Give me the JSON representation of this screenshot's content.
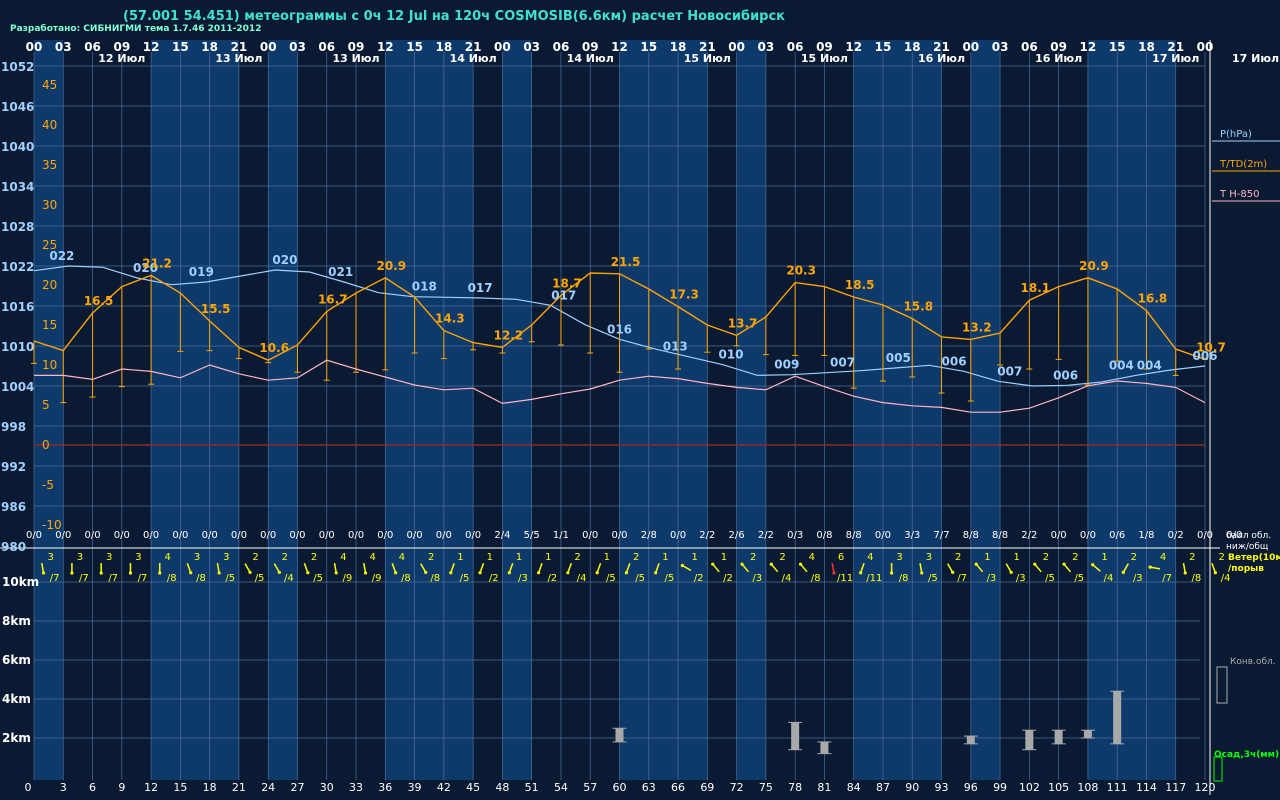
{
  "header": {
    "title": "(57.001 54.451) метеограммы с  0ч 12 Jul на 120ч COSMOSIB(6.6км) расчет Новосибирск",
    "credit": "Разработано: СИБНИГМИ тема 1.7.46 2011-2012"
  },
  "colors": {
    "background": "#0b1a33",
    "band_dark": "#0b1a33",
    "band_light": "#0e3a6b",
    "pressure": "#9fd0ff",
    "temperature": "#ffa500",
    "t850": "#ffb6c1",
    "wind": "#ffff00",
    "wind_gust_alert": "#ff3030",
    "cloud_bar": "#a9a9a9",
    "zero_line": "#8b2a2a",
    "grid": "#4b6e99"
  },
  "time_axis": {
    "top_hours": [
      "00",
      "03",
      "06",
      "09",
      "12",
      "15",
      "18",
      "21",
      "00",
      "03",
      "06",
      "09",
      "12",
      "15",
      "18",
      "21",
      "00",
      "03",
      "06",
      "09",
      "12",
      "15",
      "18",
      "21",
      "00",
      "03",
      "06",
      "09",
      "12",
      "15",
      "18",
      "21",
      "00",
      "03",
      "06",
      "09",
      "12",
      "15",
      "18",
      "21",
      "00"
    ],
    "day_labels": [
      "12 Июл",
      "13 Июл",
      "13 Июл",
      "14 Июл",
      "14 Июл",
      "15 Июл",
      "15 Июл",
      "16 Июл",
      "16 Июл",
      "17 Июл"
    ],
    "right_day_label": "17 Июл",
    "bottom_hours": [
      "0",
      "3",
      "6",
      "9",
      "12",
      "15",
      "18",
      "21",
      "24",
      "27",
      "30",
      "33",
      "36",
      "39",
      "42",
      "45",
      "48",
      "51",
      "54",
      "57",
      "60",
      "63",
      "66",
      "69",
      "72",
      "75",
      "78",
      "81",
      "84",
      "87",
      "90",
      "93",
      "96",
      "99",
      "102",
      "105",
      "108",
      "111",
      "114",
      "117",
      "120"
    ]
  },
  "left_axis": {
    "pressure_ticks": [
      "1052",
      "1046",
      "1040",
      "1034",
      "1028",
      "1022",
      "1016",
      "1010",
      "1004",
      "998",
      "992",
      "986",
      "980"
    ],
    "temp_ticks": [
      "45",
      "40",
      "35",
      "30",
      "25",
      "20",
      "15",
      "10",
      "5",
      "0",
      "-5",
      "-10"
    ]
  },
  "height_axis": [
    "10km",
    "8km",
    "6km",
    "4km",
    "2km"
  ],
  "legend": {
    "pressure": "P(hPa)",
    "temperature": "T/TD(2m)",
    "t850": "T H-850",
    "wind_line1": "Ветер(10м",
    "wind_line2": "/порыв",
    "clouds_line1": "балл обл.",
    "clouds_line2": "ниж/общ",
    "convective": "Конв.обл.",
    "precip": "Осад,3ч(мм)"
  },
  "chart_data": {
    "type": "line",
    "x_hours": [
      0,
      3,
      6,
      9,
      12,
      15,
      18,
      21,
      24,
      27,
      30,
      33,
      36,
      39,
      42,
      45,
      48,
      51,
      54,
      57,
      60,
      63,
      66,
      69,
      72,
      75,
      78,
      81,
      84,
      87,
      90,
      93,
      96,
      99,
      102,
      105,
      108,
      111,
      114,
      117,
      120
    ],
    "series": [
      {
        "name": "P(hPa)",
        "axis": "pressure",
        "values": [
          1021.3,
          1022.0,
          1021.8,
          1020.2,
          1019.2,
          1019.6,
          1020.5,
          1021.4,
          1021.1,
          1019.6,
          1018.0,
          1017.4,
          1017.3,
          1017.2,
          1017.0,
          1016.1,
          1013.2,
          1011.0,
          1009.6,
          1008.4,
          1007.2,
          1005.6,
          1005.7,
          1006.0,
          1006.3,
          1006.7,
          1007.1,
          1006.2,
          1004.7,
          1004.0,
          1004.1,
          1004.6,
          1005.6,
          1006.4,
          1007.0
        ],
        "x_start": 0
      },
      {
        "name": "T/TD(2m)",
        "axis": "temperature",
        "values": [
          13.0,
          11.8,
          16.5,
          19.8,
          21.2,
          19.0,
          15.5,
          12.2,
          10.6,
          12.5,
          16.7,
          19.0,
          20.9,
          18.5,
          14.3,
          12.8,
          12.2,
          15.0,
          18.7,
          21.5,
          21.4,
          19.5,
          17.3,
          15.0,
          13.7,
          16.0,
          20.3,
          19.8,
          18.5,
          17.5,
          15.8,
          13.5,
          13.2,
          14.0,
          18.1,
          19.8,
          20.9,
          19.5,
          16.8,
          12.0,
          10.7
        ]
      },
      {
        "name": "TD(2m)",
        "axis": "temperature",
        "values": [
          10.2,
          5.3,
          6.0,
          7.3,
          7.6,
          11.7,
          11.8,
          10.8,
          10.3,
          9.1,
          8.1,
          9.1,
          9.4,
          11.5,
          10.8,
          11.9,
          11.5,
          12.9,
          12.5,
          11.5,
          9.1,
          12.0,
          9.5,
          11.6,
          12.4,
          11.3,
          11.2,
          11.2,
          7.1,
          8.0,
          8.5,
          6.5,
          5.5,
          10.0,
          9.5,
          10.7,
          7.5,
          10.5,
          9.5,
          8.7,
          10.7
        ]
      },
      {
        "name": "T H-850",
        "axis": "temperature",
        "values": [
          8.7,
          8.7,
          8.2,
          9.5,
          9.2,
          8.4,
          10.0,
          8.9,
          8.1,
          8.4,
          10.6,
          9.5,
          8.5,
          7.5,
          6.9,
          7.1,
          5.2,
          5.7,
          6.4,
          7.0,
          8.1,
          8.6,
          8.3,
          7.7,
          7.2,
          6.9,
          8.6,
          7.3,
          6.1,
          5.3,
          4.9,
          4.7,
          4.1,
          4.1,
          4.6,
          5.9,
          7.4,
          8.0,
          7.7,
          7.2,
          5.3
        ]
      }
    ],
    "pressure_labels": [
      {
        "hour": 3,
        "text": "022"
      },
      {
        "hour": 12,
        "text": "020"
      },
      {
        "hour": 18,
        "text": "019"
      },
      {
        "hour": 27,
        "text": "020"
      },
      {
        "hour": 33,
        "text": "021"
      },
      {
        "hour": 42,
        "text": "018"
      },
      {
        "hour": 48,
        "text": "017"
      },
      {
        "hour": 57,
        "text": "017"
      },
      {
        "hour": 63,
        "text": "016"
      },
      {
        "hour": 69,
        "text": "013"
      },
      {
        "hour": 75,
        "text": "010"
      },
      {
        "hour": 81,
        "text": "009"
      },
      {
        "hour": 87,
        "text": "007"
      },
      {
        "hour": 93,
        "text": "005"
      },
      {
        "hour": 99,
        "text": "006"
      },
      {
        "hour": 105,
        "text": "007"
      },
      {
        "hour": 111,
        "text": "006"
      },
      {
        "hour": 117,
        "text": "004"
      },
      {
        "hour": 120,
        "text": "004"
      },
      {
        "hour": 126,
        "text": "006"
      }
    ],
    "temp_labels": [
      {
        "hour": 6,
        "text": "16.5"
      },
      {
        "hour": 12,
        "text": "21.2"
      },
      {
        "hour": 18,
        "text": "15.5"
      },
      {
        "hour": 24,
        "text": "10.6"
      },
      {
        "hour": 30,
        "text": "16.7"
      },
      {
        "hour": 36,
        "text": "20.9"
      },
      {
        "hour": 42,
        "text": "14.3"
      },
      {
        "hour": 48,
        "text": "12.2"
      },
      {
        "hour": 54,
        "text": "18.7"
      },
      {
        "hour": 60,
        "text": "21.5"
      },
      {
        "hour": 66,
        "text": "17.3"
      },
      {
        "hour": 72,
        "text": "13.7"
      },
      {
        "hour": 78,
        "text": "20.3"
      },
      {
        "hour": 84,
        "text": "18.5"
      },
      {
        "hour": 90,
        "text": "15.8"
      },
      {
        "hour": 96,
        "text": "13.2"
      },
      {
        "hour": 102,
        "text": "18.1"
      },
      {
        "hour": 108,
        "text": "20.9"
      },
      {
        "hour": 114,
        "text": "16.8"
      },
      {
        "hour": 120,
        "text": "10.7"
      }
    ],
    "cloud_cover": [
      "0/0",
      "0/0",
      "0/0",
      "0/0",
      "0/0",
      "0/0",
      "0/0",
      "0/0",
      "0/0",
      "0/0",
      "0/0",
      "0/0",
      "0/0",
      "0/0",
      "0/0",
      "0/0",
      "2/4",
      "5/5",
      "1/1",
      "0/0",
      "0/0",
      "2/8",
      "0/0",
      "2/2",
      "2/6",
      "2/2",
      "0/3",
      "0/8",
      "8/8",
      "0/0",
      "3/3",
      "7/7",
      "8/8",
      "8/8",
      "2/2",
      "0/0",
      "0/0",
      "0/6",
      "1/8",
      "0/2",
      "0/0",
      "0/0"
    ],
    "wind_speed": [
      "3",
      "3",
      "3",
      "3",
      "4",
      "3",
      "3",
      "2",
      "2",
      "2",
      "4",
      "4",
      "4",
      "2",
      "1",
      "1",
      "1",
      "1",
      "2",
      "1",
      "2",
      "1",
      "1",
      "1",
      "2",
      "2",
      "4",
      "6",
      "4",
      "3",
      "3",
      "2",
      "1",
      "1",
      "2",
      "2",
      "1",
      "2",
      "4",
      "2",
      "2"
    ],
    "wind_gust": [
      "/7",
      "/7",
      "/7",
      "/7",
      "/8",
      "/8",
      "/5",
      "/5",
      "/4",
      "/5",
      "/9",
      "/9",
      "/8",
      "/8",
      "/5",
      "/2",
      "/3",
      "/2",
      "/4",
      "/5",
      "/5",
      "/5",
      "/2",
      "/2",
      "/3",
      "/4",
      "/8",
      "/11",
      "/11",
      "/8",
      "/5",
      "/7",
      "/3",
      "/3",
      "/5",
      "/5",
      "/4",
      "/3",
      "/7",
      "/8",
      "/4"
    ],
    "wind_dir_deg": [
      170,
      180,
      180,
      180,
      180,
      160,
      170,
      150,
      150,
      160,
      170,
      170,
      160,
      150,
      200,
      200,
      200,
      200,
      200,
      200,
      200,
      200,
      300,
      320,
      320,
      320,
      320,
      170,
      200,
      180,
      170,
      150,
      320,
      150,
      320,
      320,
      310,
      210,
      280,
      170,
      160
    ],
    "convective_clouds": [
      {
        "hour": 60,
        "base_km": 1.8,
        "top_km": 2.5
      },
      {
        "hour": 78,
        "base_km": 1.4,
        "top_km": 2.8
      },
      {
        "hour": 81,
        "base_km": 1.2,
        "top_km": 1.8
      },
      {
        "hour": 96,
        "base_km": 1.7,
        "top_km": 2.1
      },
      {
        "hour": 102,
        "base_km": 1.4,
        "top_km": 2.4
      },
      {
        "hour": 105,
        "base_km": 1.7,
        "top_km": 2.4
      },
      {
        "hour": 108,
        "base_km": 2.0,
        "top_km": 2.4
      },
      {
        "hour": 111,
        "base_km": 1.7,
        "top_km": 4.4
      }
    ],
    "pressure_range": [
      980,
      1052
    ],
    "temperature_range": [
      -10,
      45
    ],
    "height_range_km": [
      0,
      10
    ]
  }
}
